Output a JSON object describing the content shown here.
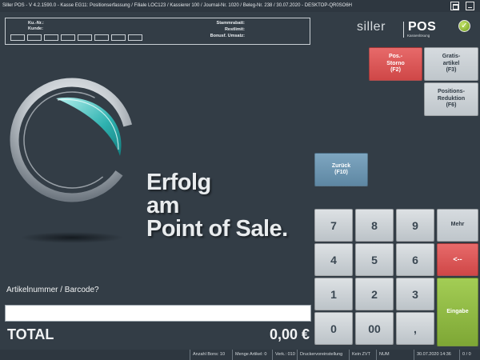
{
  "window": {
    "title": "Siller POS - V 4.2.1590.0 - Kasse EG11: Positionserfassung / Filiale LOC123 / Kassierer 100 / Journal-Nr. 1020 / Beleg-Nr. 238 / 30.07.2020 - DESKTOP-QR0SO6H"
  },
  "customer": {
    "kunr_label": "Ku.-Nr.:",
    "kunde_label": "Kunde:",
    "stammrabatt_label": "Stammrabatt:",
    "restlimit_label": "Restlimit:",
    "bonus_label": "Bonusf. Umsatz:",
    "digit_box_count": 8
  },
  "logo": {
    "name_light": "siller",
    "name_bold": "POS",
    "subtitle": "Kassenlösung"
  },
  "slogan": {
    "line1": "Erfolg",
    "line2": "am",
    "line3": "Point of Sale."
  },
  "buttons": {
    "pos_storno": "Pos.-\nStorno\n(F2)",
    "gratisartikel": "Gratis-\nartikel\n(F3)",
    "positionsreduktion": "Positions-\nReduktion\n(F6)",
    "zurueck": "Zurück\n(F10)",
    "mehr": "Mehr",
    "backspace": "<--",
    "eingabe": "Eingabe"
  },
  "keypad": {
    "k7": "7",
    "k8": "8",
    "k9": "9",
    "k4": "4",
    "k5": "5",
    "k6": "6",
    "k1": "1",
    "k2": "2",
    "k3": "3",
    "k0": "0",
    "k00": "00",
    "kcomma": ","
  },
  "entry": {
    "prompt": "Artikelnummer / Barcode?",
    "value": "",
    "placeholder": ""
  },
  "total": {
    "label": "TOTAL",
    "value": "0,00 €"
  },
  "status": {
    "anzahl_bons": "Anzahl Bons: 10",
    "menge_artikel": "Menge Artikel: 0",
    "verk": "Verk.: 010",
    "drucker": "Druckervoreinstellung",
    "zvt": "Kein ZVT",
    "num": "NUM",
    "datetime": "30.07.2020 14:36",
    "counter": "0 / 0"
  },
  "colors": {
    "background": "#333d46",
    "red_button": "#d95252",
    "grey_button": "#c9cfd4",
    "blue_button": "#6e97b2",
    "green_button": "#8fba44"
  }
}
